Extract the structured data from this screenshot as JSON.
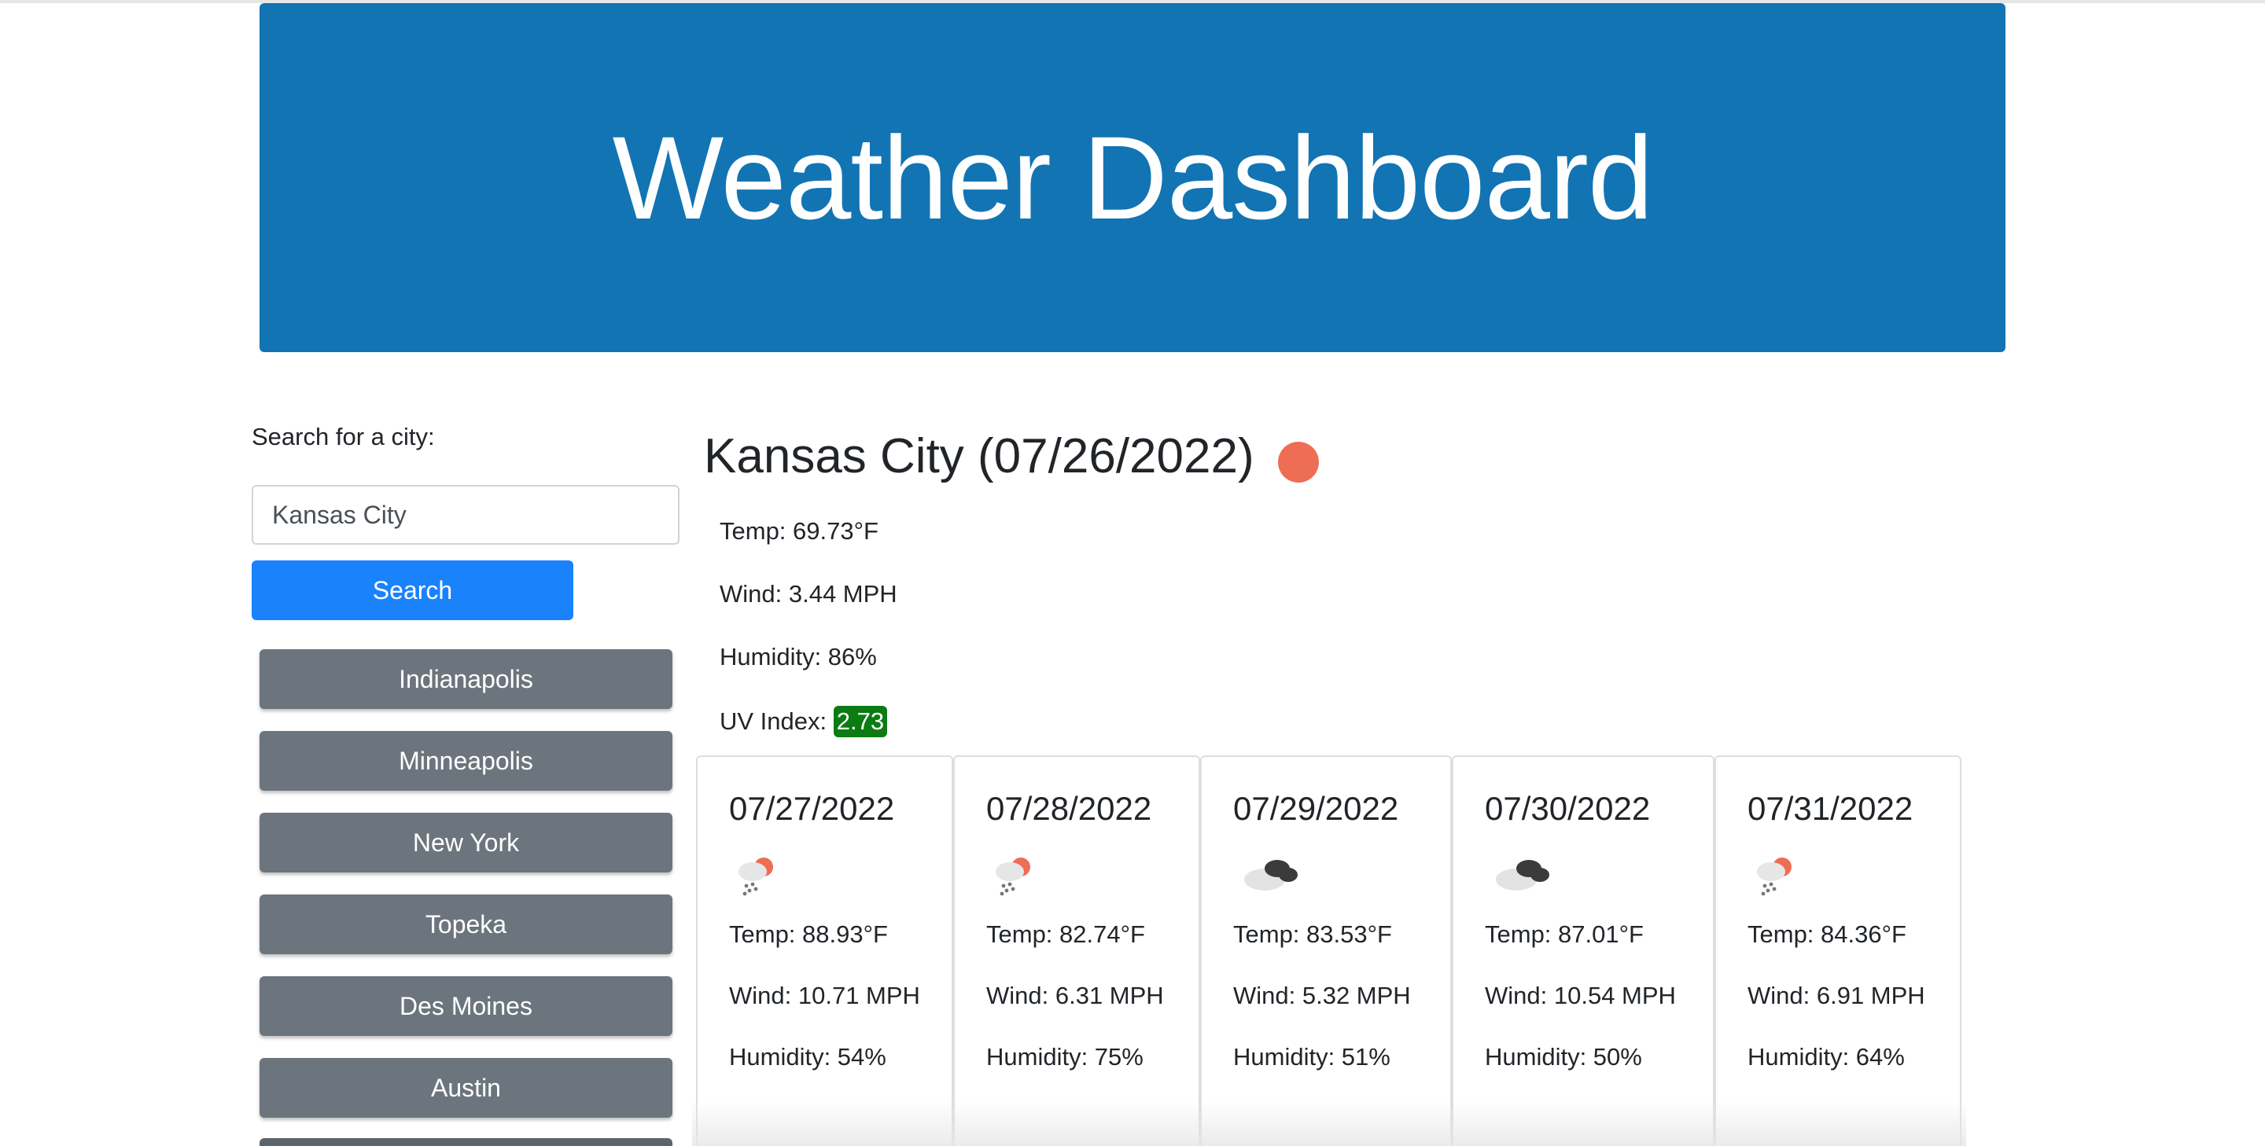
{
  "header": {
    "title": "Weather Dashboard"
  },
  "search": {
    "label": "Search for a city:",
    "value": "Kansas City",
    "placeholder": "",
    "button_label": "Search"
  },
  "history": [
    "Indianapolis",
    "Minneapolis",
    "New York",
    "Topeka",
    "Des Moines",
    "Austin"
  ],
  "current": {
    "title": "Kansas City (07/26/2022)",
    "icon": "sun-icon",
    "temp": "Temp: 69.73°F",
    "wind": "Wind: 3.44 MPH",
    "humidity": "Humidity: 86%",
    "uv_label": "UV Index: ",
    "uv_value": "2.73",
    "uv_color": "#0b7c13"
  },
  "forecast": [
    {
      "date": "07/27/2022",
      "icon": "rain-sun-icon",
      "temp": "Temp: 88.93°F",
      "wind": "Wind: 10.71 MPH",
      "humidity": "Humidity: 54%"
    },
    {
      "date": "07/28/2022",
      "icon": "rain-sun-icon",
      "temp": "Temp: 82.74°F",
      "wind": "Wind: 6.31 MPH",
      "humidity": "Humidity: 75%"
    },
    {
      "date": "07/29/2022",
      "icon": "broken-clouds-icon",
      "temp": "Temp: 83.53°F",
      "wind": "Wind: 5.32 MPH",
      "humidity": "Humidity: 51%"
    },
    {
      "date": "07/30/2022",
      "icon": "broken-clouds-icon",
      "temp": "Temp: 87.01°F",
      "wind": "Wind: 10.54 MPH",
      "humidity": "Humidity: 50%"
    },
    {
      "date": "07/31/2022",
      "icon": "rain-sun-icon",
      "temp": "Temp: 84.36°F",
      "wind": "Wind: 6.91 MPH",
      "humidity": "Humidity: 64%"
    }
  ],
  "colors": {
    "header_bg": "#1274b3",
    "search_button": "#1a82fb",
    "history_button": "#6c757d",
    "sun_icon": "#ee6e55"
  }
}
